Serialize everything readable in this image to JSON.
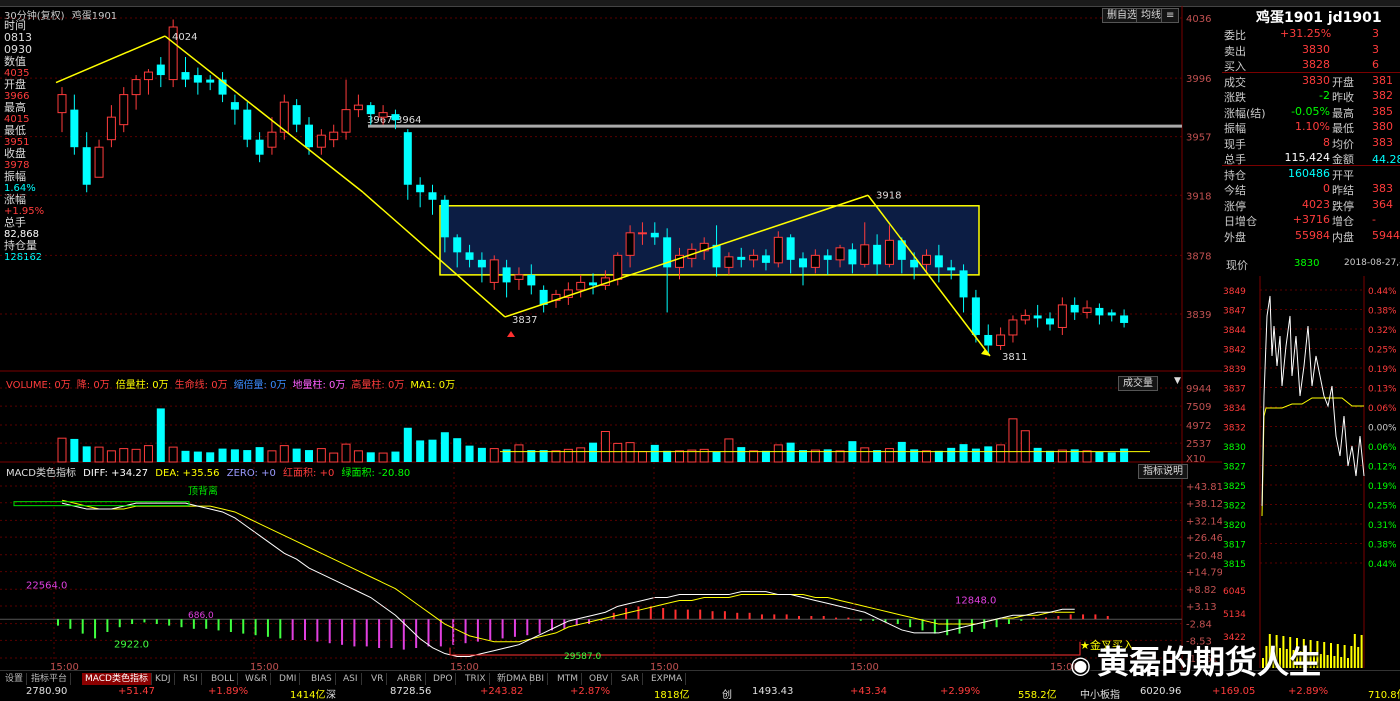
{
  "window": {
    "symbol_label": "30分钟(复权)",
    "symbol_name": "鸡蛋1901"
  },
  "info_panel": [
    {
      "label": "时间",
      "value": ""
    },
    {
      "label": "0813",
      "value": ""
    },
    {
      "label": "0930",
      "value": ""
    },
    {
      "label": "数值",
      "value": "4035"
    },
    {
      "label": "开盘",
      "value": "3966"
    },
    {
      "label": "最高",
      "value": "4015"
    },
    {
      "label": "最低",
      "value": "3951"
    },
    {
      "label": "收盘",
      "value": "3978"
    },
    {
      "label": "振幅",
      "value": "1.64%"
    },
    {
      "label": "涨幅",
      "value": "+1.95%"
    },
    {
      "label": "总手",
      "value": "82,868"
    },
    {
      "label": "持仓量",
      "value": "128162"
    }
  ],
  "toolbar_right": {
    "btn1": "删自选",
    "btn2": "均线",
    "ma_label": "成交量"
  },
  "price_axis": [
    "4036",
    "3996",
    "3957",
    "3918",
    "3878",
    "3839"
  ],
  "annotations": {
    "high": "4024",
    "range": "3967-3964",
    "peak": "3918",
    "low1": "3837",
    "low2": "3811"
  },
  "volume_header": {
    "items": [
      "VOLUME: 0万",
      "降: 0万",
      "倍量柱: 0万",
      "生命线: 0万",
      "缩倍量: 0万",
      "地量柱: 0万",
      "高量柱: 0万",
      "MA1: 0万"
    ],
    "dropdown": "成交量"
  },
  "volume_axis": [
    "9944",
    "7509",
    "4972",
    "2537",
    "X10"
  ],
  "macd_header": {
    "name": "MACD类色指标",
    "diff": "DIFF: +34.27",
    "dea": "DEA: +35.56",
    "zero": "ZERO: +0",
    "red_area": "红面积: +0",
    "green_area": "绿面积: -20.80",
    "help": "指标说明"
  },
  "macd_axis": [
    "+43.81",
    "+38.12",
    "+32.14",
    "+26.46",
    "+20.48",
    "+14.79",
    "+8.82",
    "+3.13",
    "-2.84",
    "-8.53",
    "-14.51"
  ],
  "macd_labels": {
    "top_div": "顶背离",
    "v1": "22564.0",
    "v2": "2922.0",
    "v3": "12848.0",
    "v4": "29587.0",
    "v5": "686.0",
    "buy": "金叉买入"
  },
  "time_axis": [
    "15:00",
    "15:00",
    "15:00",
    "15:00",
    "15:00",
    "15:00"
  ],
  "quote": {
    "title": "鸡蛋1901 jd1901",
    "rows": [
      {
        "l1": "委比",
        "v1": "+31.25%",
        "l2": "",
        "v2": "3"
      },
      {
        "l1": "卖出",
        "v1": "3830",
        "l2": "",
        "v2": "3"
      },
      {
        "l1": "买入",
        "v1": "3828",
        "l2": "",
        "v2": "6"
      },
      {
        "l1": "成交",
        "v1": "3830",
        "l2": "开盘",
        "v2": "381"
      },
      {
        "l1": "涨跌",
        "v1": "-2",
        "l2": "昨收",
        "v2": "382"
      },
      {
        "l1": "涨幅(结)",
        "v1": "-0.05%",
        "l2": "最高",
        "v2": "385"
      },
      {
        "l1": "振幅",
        "v1": "1.10%",
        "l2": "最低",
        "v2": "380"
      },
      {
        "l1": "现手",
        "v1": "8",
        "l2": "均价",
        "v2": "383"
      },
      {
        "l1": "总手",
        "v1": "115,424",
        "l2": "金额",
        "v2": "44.28亿"
      },
      {
        "l1": "持仓",
        "v1": "160486",
        "l2": "开平",
        "v2": ""
      },
      {
        "l1": "今结",
        "v1": "0",
        "l2": "昨结",
        "v2": "383"
      },
      {
        "l1": "涨停",
        "v1": "4023",
        "l2": "跌停",
        "v2": "364"
      },
      {
        "l1": "日增仓",
        "v1": "+3716",
        "l2": "增仓",
        "v2": "-"
      },
      {
        "l1": "外盘",
        "v1": "55984",
        "l2": "内盘",
        "v2": "5944"
      }
    ],
    "now_label": "现价",
    "now_value": "3830",
    "date": "2018-08-27,-"
  },
  "mini_chart": {
    "price_ticks": [
      "3849",
      "3847",
      "3844",
      "3842",
      "3839",
      "3837",
      "3834",
      "3832",
      "3830",
      "3827",
      "3825",
      "3822",
      "3820",
      "3817",
      "3815"
    ],
    "pct_ticks": [
      "0.44%",
      "0.38%",
      "0.32%",
      "0.25%",
      "0.19%",
      "0.13%",
      "0.06%",
      "0.00%",
      "0.06%",
      "0.12%",
      "0.19%",
      "0.25%",
      "0.31%",
      "0.38%",
      "0.44%"
    ],
    "vol_ticks": [
      "6045",
      "5134",
      "3422"
    ]
  },
  "bottom_tabs": [
    "设置",
    "指标平台",
    "MACD类色指标",
    "KDJ",
    "RSI",
    "BOLL",
    "W&R",
    "DMI",
    "BIAS",
    "ASI",
    "VR",
    "ARBR",
    "DPO",
    "TRIX",
    "新DMA",
    "BBI",
    "MTM",
    "OBV",
    "SAR",
    "EXPMA"
  ],
  "status_bar": [
    "2780.90",
    "+51.47",
    "+1.89%",
    "1414亿",
    "深",
    "8728.56",
    "+243.82",
    "+2.87%",
    "1818亿",
    "创",
    "1493.43",
    "+43.34",
    "+2.99%",
    "558.2亿",
    "中小板指",
    "6020.96",
    "+169.05",
    "+2.89%",
    "710.8亿"
  ],
  "watermark": "黄磊的期货人生",
  "colors": {
    "up": "#ff3c3c",
    "down": "#00ffff",
    "arrow": "#ffff00",
    "box_fill": "#0c1d44"
  },
  "chart_data": {
    "type": "candlestick",
    "title": "鸡蛋1901 30分钟",
    "candles": [
      [
        3973,
        3985,
        3960,
        3990
      ],
      [
        3975,
        3950,
        3945,
        3985
      ],
      [
        3950,
        3925,
        3920,
        3960
      ],
      [
        3930,
        3950,
        3930,
        3955
      ],
      [
        3955,
        3970,
        3950,
        3978
      ],
      [
        3965,
        3985,
        3960,
        3990
      ],
      [
        3985,
        3995,
        3975,
        3998
      ],
      [
        3995,
        4000,
        3985,
        4002
      ],
      [
        4005,
        3998,
        3990,
        4010
      ],
      [
        3995,
        4030,
        3990,
        4035
      ],
      [
        4000,
        3995,
        3990,
        4010
      ],
      [
        3998,
        3993,
        3985,
        4003
      ],
      [
        3995,
        3993,
        3988,
        3998
      ],
      [
        3995,
        3985,
        3980,
        4000
      ],
      [
        3980,
        3975,
        3965,
        3985
      ],
      [
        3975,
        3955,
        3950,
        3980
      ],
      [
        3955,
        3945,
        3940,
        3960
      ],
      [
        3950,
        3960,
        3945,
        3970
      ],
      [
        3960,
        3980,
        3955,
        3985
      ],
      [
        3978,
        3965,
        3960,
        3982
      ],
      [
        3965,
        3950,
        3945,
        3970
      ],
      [
        3950,
        3958,
        3945,
        3962
      ],
      [
        3955,
        3960,
        3950,
        3965
      ],
      [
        3960,
        3975,
        3955,
        3995
      ],
      [
        3975,
        3978,
        3970,
        3985
      ],
      [
        3978,
        3972,
        3965,
        3980
      ],
      [
        3970,
        3973,
        3965,
        3978
      ],
      [
        3972,
        3968,
        3962,
        3975
      ],
      [
        3960,
        3925,
        3915,
        3962
      ],
      [
        3925,
        3920,
        3910,
        3930
      ],
      [
        3920,
        3915,
        3905,
        3925
      ],
      [
        3915,
        3890,
        3880,
        3918
      ],
      [
        3890,
        3880,
        3870,
        3892
      ],
      [
        3880,
        3875,
        3870,
        3885
      ],
      [
        3875,
        3870,
        3860,
        3880
      ],
      [
        3860,
        3875,
        3855,
        3878
      ],
      [
        3870,
        3860,
        3850,
        3875
      ],
      [
        3862,
        3865,
        3855,
        3870
      ],
      [
        3865,
        3858,
        3852,
        3872
      ],
      [
        3855,
        3845,
        3840,
        3858
      ],
      [
        3848,
        3852,
        3843,
        3855
      ],
      [
        3850,
        3855,
        3845,
        3860
      ],
      [
        3855,
        3860,
        3850,
        3865
      ],
      [
        3860,
        3858,
        3852,
        3866
      ],
      [
        3858,
        3863,
        3855,
        3868
      ],
      [
        3862,
        3878,
        3858,
        3880
      ],
      [
        3878,
        3893,
        3870,
        3898
      ],
      [
        3893,
        3893,
        3885,
        3900
      ],
      [
        3893,
        3890,
        3885,
        3900
      ],
      [
        3890,
        3870,
        3840,
        3896
      ],
      [
        3870,
        3878,
        3862,
        3883
      ],
      [
        3876,
        3882,
        3870,
        3886
      ],
      [
        3881,
        3886,
        3875,
        3890
      ],
      [
        3885,
        3870,
        3864,
        3898
      ],
      [
        3870,
        3877,
        3865,
        3880
      ],
      [
        3877,
        3875,
        3870,
        3883
      ],
      [
        3875,
        3878,
        3870,
        3882
      ],
      [
        3878,
        3873,
        3868,
        3882
      ],
      [
        3873,
        3890,
        3870,
        3894
      ],
      [
        3890,
        3875,
        3866,
        3892
      ],
      [
        3876,
        3870,
        3858,
        3880
      ],
      [
        3870,
        3878,
        3866,
        3882
      ],
      [
        3878,
        3875,
        3865,
        3882
      ],
      [
        3875,
        3883,
        3870,
        3885
      ],
      [
        3882,
        3872,
        3866,
        3886
      ],
      [
        3872,
        3885,
        3870,
        3900
      ],
      [
        3885,
        3872,
        3865,
        3892
      ],
      [
        3872,
        3888,
        3870,
        3898
      ],
      [
        3888,
        3875,
        3866,
        3890
      ],
      [
        3875,
        3870,
        3862,
        3880
      ],
      [
        3872,
        3878,
        3866,
        3882
      ],
      [
        3878,
        3870,
        3860,
        3885
      ],
      [
        3870,
        3868,
        3862,
        3875
      ],
      [
        3868,
        3850,
        3840,
        3872
      ],
      [
        3850,
        3825,
        3820,
        3855
      ],
      [
        3825,
        3818,
        3812,
        3832
      ],
      [
        3818,
        3825,
        3815,
        3830
      ],
      [
        3825,
        3835,
        3820,
        3838
      ],
      [
        3835,
        3838,
        3832,
        3842
      ],
      [
        3838,
        3836,
        3830,
        3845
      ],
      [
        3836,
        3832,
        3828,
        3840
      ],
      [
        3830,
        3845,
        3825,
        3850
      ],
      [
        3845,
        3840,
        3835,
        3850
      ],
      [
        3840,
        3843,
        3836,
        3848
      ],
      [
        3843,
        3838,
        3832,
        3846
      ],
      [
        3840,
        3838,
        3834,
        3842
      ],
      [
        3838,
        3833,
        3830,
        3842
      ]
    ],
    "volume": [
      3200,
      3100,
      2100,
      2000,
      1500,
      1800,
      1700,
      2200,
      7200,
      2000,
      1500,
      1400,
      1300,
      1800,
      1700,
      1600,
      2000,
      1500,
      2200,
      1800,
      1600,
      1800,
      1200,
      2400,
      1500,
      1300,
      1200,
      1400,
      4600,
      2900,
      3000,
      4000,
      3200,
      2200,
      1900,
      1800,
      1700,
      2300,
      1600,
      1600,
      1500,
      1700,
      1900,
      2600,
      4100,
      2500,
      2600,
      1400,
      2300,
      1500,
      1500,
      1600,
      1700,
      1400,
      3100,
      2000,
      1500,
      1500,
      2300,
      2600,
      1600,
      1600,
      1700,
      1500,
      2800,
      1900,
      1600,
      1800,
      2700,
      1700,
      1500,
      1500,
      1900,
      2400,
      1800,
      2100,
      2300,
      5800,
      4200,
      1900,
      1500,
      1600,
      1700,
      1500,
      1400,
      1300,
      1800,
      1400
    ],
    "ylim": [
      3811,
      4036
    ]
  }
}
